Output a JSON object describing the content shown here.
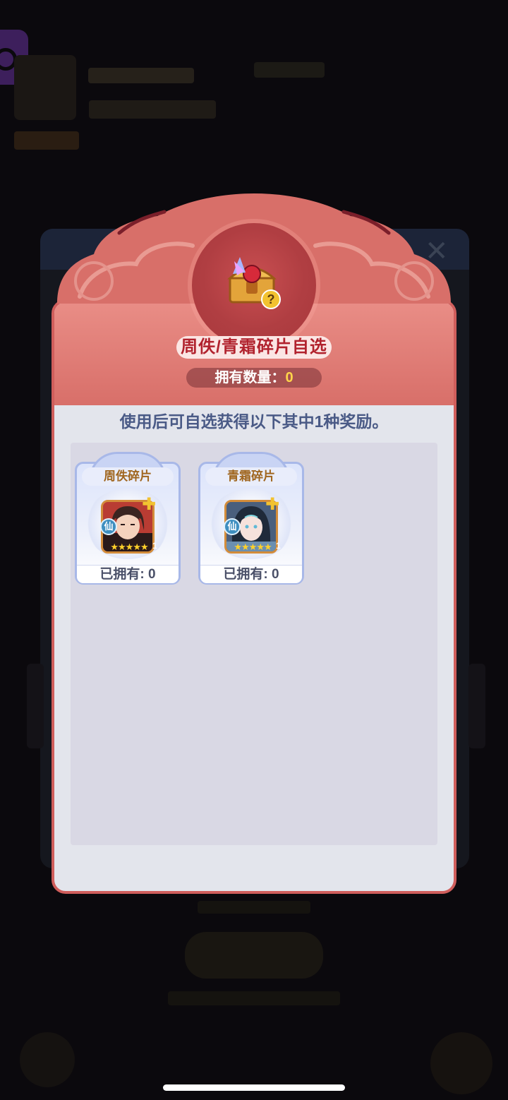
{
  "modal": {
    "title": "周佚/青霜碎片自选",
    "count_label": "拥有数量：",
    "count_value": "0",
    "instruction": "使用后可自选获得以下其中1种奖励。",
    "rewards": [
      {
        "name": "周佚碎片",
        "tier": "仙",
        "stars": "★★★★★",
        "level": "1",
        "owned_text": "已拥有: 0"
      },
      {
        "name": "青霜碎片",
        "tier": "仙",
        "stars": "★★★★★",
        "level": "1",
        "owned_text": "已拥有: 0"
      }
    ]
  },
  "colors": {
    "header": "#d86f69",
    "title_text": "#b1222d",
    "count_value": "#ffd54a",
    "instruction_text": "#4a5a86",
    "card_name_text": "#a0661f"
  }
}
